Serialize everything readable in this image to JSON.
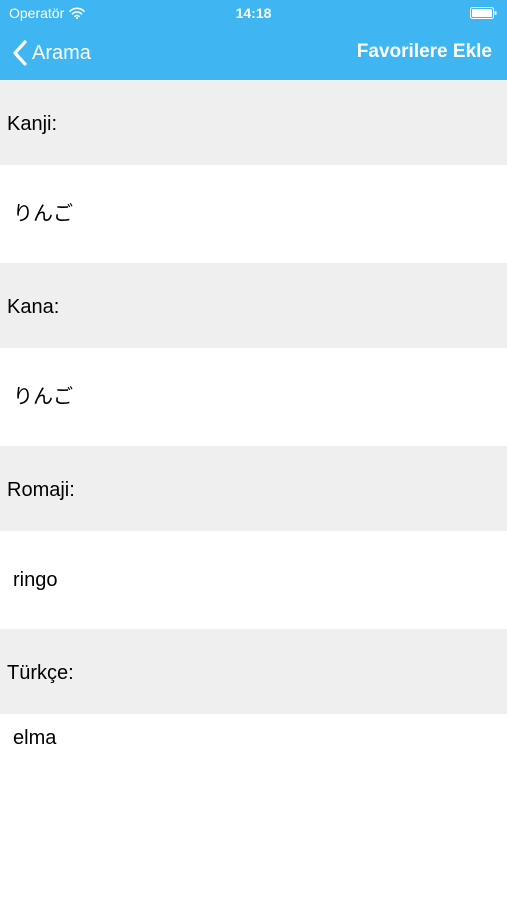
{
  "status_bar": {
    "carrier": "Operatör",
    "time": "14:18",
    "icons": [
      "wifi-icon",
      "battery-icon"
    ]
  },
  "nav": {
    "back_label": "Arama",
    "action_label": "Favorilere Ekle",
    "accent_color": "#3fb6f2"
  },
  "fields": {
    "kanji": {
      "label": "Kanji:",
      "value": "りんご"
    },
    "kana": {
      "label": "Kana:",
      "value": "りんご"
    },
    "romaji": {
      "label": "Romaji:",
      "value": "ringo"
    },
    "turkce": {
      "label": "Türkçe:",
      "value": "elma"
    }
  }
}
